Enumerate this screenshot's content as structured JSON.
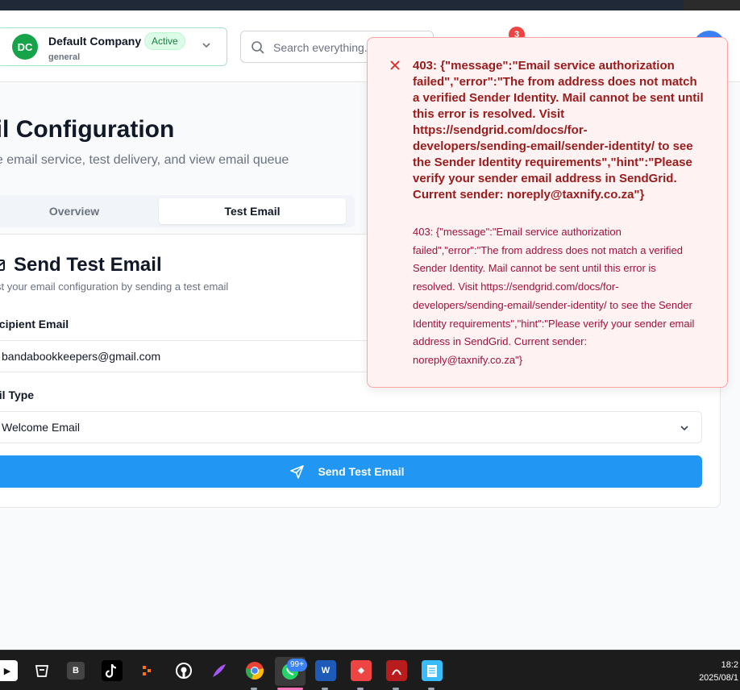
{
  "header": {
    "company": {
      "initials": "DC",
      "name": "Default Company",
      "status": "Active",
      "subtitle": "general"
    },
    "search_placeholder": "Search everything...",
    "notification_count": "3"
  },
  "page": {
    "title": "Email Configuration",
    "title_visible": "ail Configuration",
    "subtitle_visible": "ge email service, test delivery, and view email queue",
    "tabs": [
      {
        "label": "Overview"
      },
      {
        "label": "Test Email"
      }
    ],
    "active_tab": "Test Email"
  },
  "card": {
    "title": "Send Test Email",
    "subtitle_visible": "st your email configuration by sending a test email",
    "recipient_label_visible": "ecipient Email",
    "recipient_value_visible": "bandabookkeepers@gmail.com",
    "type_label_visible": "ail Type",
    "type_value_visible": "Welcome Email",
    "send_label": "Send Test Email"
  },
  "toast": {
    "title": "403: {\"message\":\"Email service authorization failed\",\"error\":\"The from address does not match a verified Sender Identity. Mail cannot be sent until this error is resolved. Visit https://sendgrid.com/docs/for-developers/sending-email/sender-identity/ to see the Sender Identity requirements\",\"hint\":\"Please verify your sender email address in SendGrid. Current sender: noreply@taxnify.co.za\"}",
    "description": "403: {\"message\":\"Email service authorization failed\",\"error\":\"The from address does not match a verified Sender Identity. Mail cannot be sent until this error is resolved. Visit https://sendgrid.com/docs/for-developers/sending-email/sender-identity/ to see the Sender Identity requirements\",\"hint\":\"Please verify your sender email address in SendGrid. Current sender: noreply@taxnify.co.za\"}"
  },
  "taskbar": {
    "apps": [
      "youtube-icon",
      "terminal-icon",
      "b-app-icon",
      "tiktok-icon",
      "dots-app-icon",
      "github-icon",
      "feather-icon",
      "chrome-icon",
      "whatsapp-icon",
      "word-icon",
      "anydesk-icon",
      "acrobat-icon",
      "notepad-icon"
    ],
    "whatsapp_badge": "99+",
    "time_visible": "18:2",
    "date_visible": "2025/08/1"
  },
  "colors": {
    "primary": "#2196f3",
    "success": "#16a34a",
    "error": "#991b1b",
    "error_bg": "#fef2f2"
  }
}
